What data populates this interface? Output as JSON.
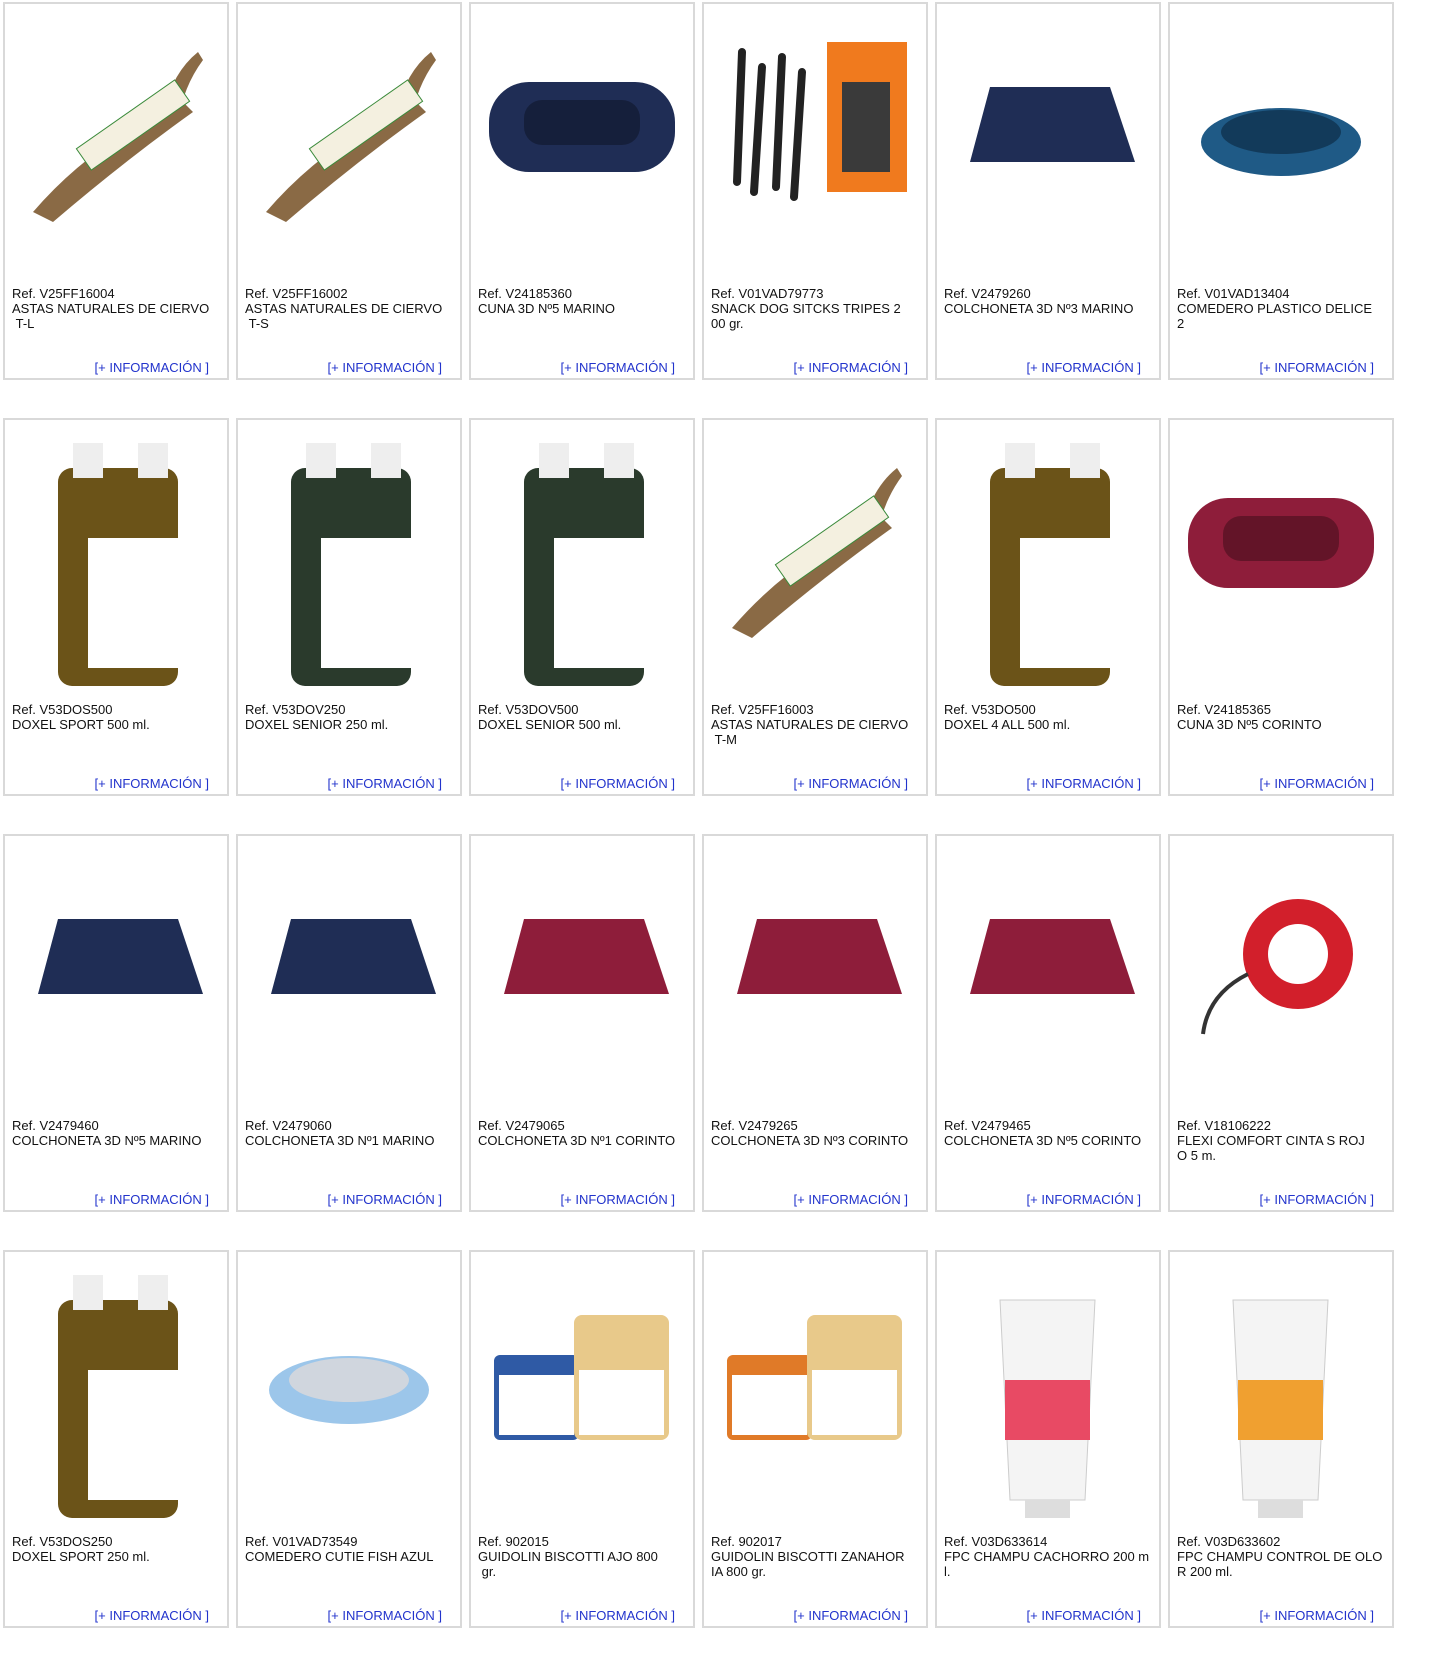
{
  "more_label": "[+ INFORMACIÓN ]",
  "rows": [
    [
      {
        "ref": "Ref. V25FF16004",
        "name": "ASTAS NATURALES DE CIERVO\n T-L",
        "icon": "antler-icon"
      },
      {
        "ref": "Ref. V25FF16002",
        "name": "ASTAS NATURALES DE CIERVO\n T-S",
        "icon": "antler-icon"
      },
      {
        "ref": "Ref. V24185360",
        "name": "CUNA 3D Nº5 MARINO",
        "icon": "dog-bed-icon"
      },
      {
        "ref": "Ref. V01VAD79773",
        "name": "SNACK DOG SITCKS TRIPES 2\n00 gr.",
        "icon": "snack-sticks-icon"
      },
      {
        "ref": "Ref. V2479260",
        "name": "COLCHONETA 3D Nº3 MARINO",
        "icon": "mattress-icon"
      },
      {
        "ref": "Ref. V01VAD13404",
        "name": "COMEDERO PLASTICO DELICE\n2",
        "icon": "bowl-icon"
      }
    ],
    [
      {
        "ref": "Ref. V53DOS500",
        "name": "DOXEL SPORT 500 ml.",
        "icon": "bottle-icon"
      },
      {
        "ref": "Ref. V53DOV250",
        "name": "DOXEL SENIOR 250 ml.",
        "icon": "bottle-icon"
      },
      {
        "ref": "Ref. V53DOV500",
        "name": "DOXEL SENIOR 500 ml.",
        "icon": "bottle-icon"
      },
      {
        "ref": "Ref. V25FF16003",
        "name": "ASTAS NATURALES DE CIERVO\n T-M",
        "icon": "antler-icon"
      },
      {
        "ref": "Ref. V53DO500",
        "name": "DOXEL 4 ALL 500 ml.",
        "icon": "bottle-icon"
      },
      {
        "ref": "Ref. V24185365",
        "name": "CUNA 3D Nº5 CORINTO",
        "icon": "dog-bed-icon"
      }
    ],
    [
      {
        "ref": "Ref. V2479460",
        "name": "COLCHONETA 3D Nº5 MARINO",
        "icon": "mattress-icon"
      },
      {
        "ref": "Ref. V2479060",
        "name": "COLCHONETA 3D Nº1 MARINO",
        "icon": "mattress-icon"
      },
      {
        "ref": "Ref. V2479065",
        "name": "COLCHONETA 3D Nº1 CORINTO",
        "icon": "mattress-icon"
      },
      {
        "ref": "Ref. V2479265",
        "name": "COLCHONETA 3D Nº3 CORINTO",
        "icon": "mattress-icon"
      },
      {
        "ref": "Ref. V2479465",
        "name": "COLCHONETA 3D Nº5 CORINTO",
        "icon": "mattress-icon"
      },
      {
        "ref": "Ref. V18106222",
        "name": "FLEXI COMFORT CINTA S ROJ\nO 5 m.",
        "icon": "leash-icon"
      }
    ],
    [
      {
        "ref": "Ref. V53DOS250",
        "name": "DOXEL SPORT 250 ml.",
        "icon": "bottle-icon"
      },
      {
        "ref": "Ref. V01VAD73549",
        "name": "COMEDERO CUTIE FISH AZUL",
        "icon": "bowl-icon"
      },
      {
        "ref": "Ref. 902015",
        "name": "GUIDOLIN BISCOTTI AJO 800\n gr.",
        "icon": "treat-tub-icon"
      },
      {
        "ref": "Ref. 902017",
        "name": "GUIDOLIN BISCOTTI ZANAHOR\nIA 800 gr.",
        "icon": "treat-tub-icon"
      },
      {
        "ref": "Ref. V03D633614",
        "name": "FPC CHAMPU CACHORRO 200 m\nl.",
        "icon": "shampoo-tube-icon"
      },
      {
        "ref": "Ref. V03D633602",
        "name": "FPC CHAMPU CONTROL DE OLO\nR 200 ml.",
        "icon": "shampoo-tube-icon"
      }
    ]
  ],
  "colors": {
    "link": "#2233cc",
    "border": "#d9d9d9",
    "navy": "#1f2d55",
    "burgundy": "#8e1d3a",
    "antler": "#8a6a45",
    "oil": "#6b5318",
    "bottle_dark": "#2a3a2c",
    "bowl_blue": "#1f5a86",
    "leash_red": "#d21f2b",
    "tube_pink": "#e84a64",
    "tube_orange": "#f0a030",
    "tub_orange": "#e07a28",
    "tub_blue": "#2f5aa5",
    "snack_orange": "#f07a1e"
  }
}
